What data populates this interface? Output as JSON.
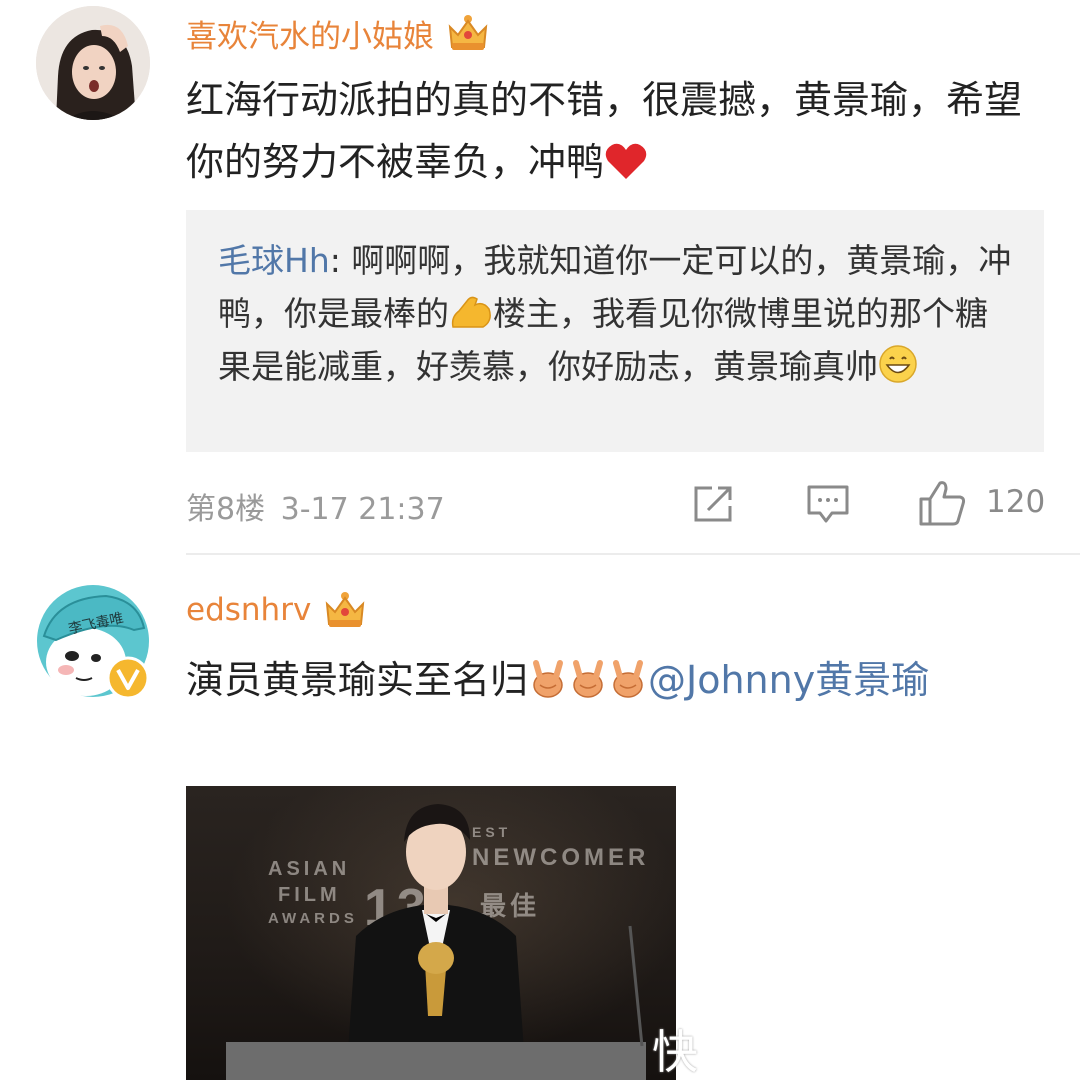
{
  "comments": [
    {
      "username": "喜欢汽水的小姑娘",
      "text": "红海行动派拍的真的不错，很震撼，黄景瑜，希望你的努力不被辜负，冲鸭",
      "reply": {
        "user": "毛球Hh",
        "text": "啊啊啊，我就知道你一定可以的，黄景瑜，冲鸭，你是最棒的",
        "text_after_muscle": "楼主，我看见你微博里说的那个糖果是能减重，好羡慕，你好励志，黄景瑜真帅"
      },
      "floor": "第8楼",
      "time": "3-17 21:37",
      "likes": "120"
    },
    {
      "username": "edsnhrv",
      "avatar_caption": "李飞毒唯",
      "text": "演员黄景瑜实至名归",
      "mention": "@Johnny黄景瑜",
      "photo": {
        "backdrop_left_lines": [
          "ASIAN",
          "FILM",
          "AWARDS"
        ],
        "backdrop_right_top": "EST",
        "backdrop_right": "NEWCOMER",
        "backdrop_number": "13",
        "backdrop_cn": "最佳"
      }
    }
  ],
  "watermark": "快",
  "colors": {
    "username": "#e8843a",
    "link": "#5177a8",
    "reply_bg": "#f2f2f2",
    "meta": "#9a9a9a"
  },
  "icons": [
    "crown-icon",
    "heart-icon",
    "muscle-emoji-icon",
    "grin-emoji-icon",
    "share-icon",
    "comment-icon",
    "like-icon",
    "victory-hand-emoji-icon",
    "verified-badge-icon"
  ]
}
